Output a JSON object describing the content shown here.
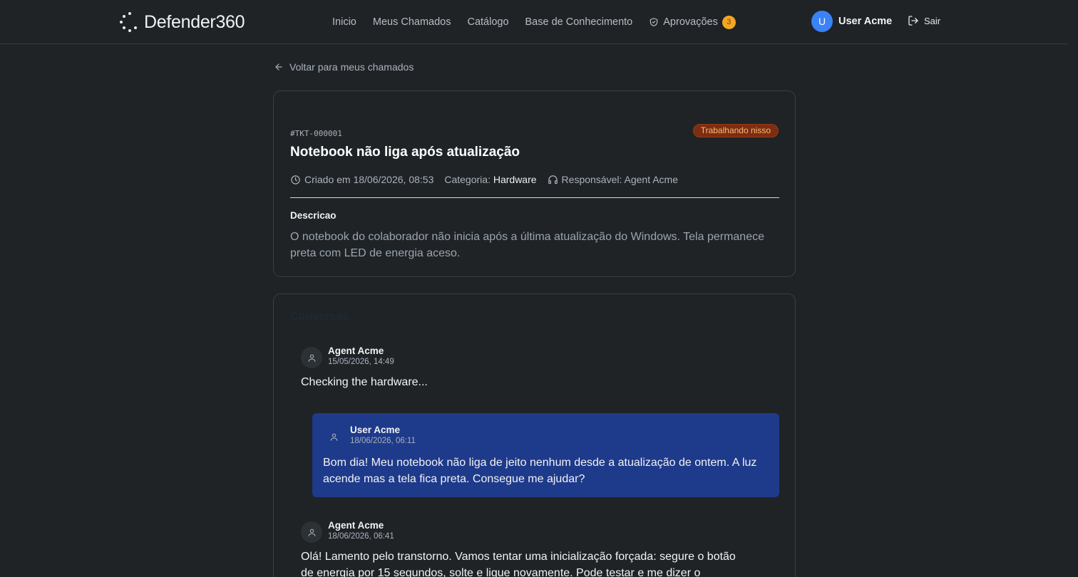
{
  "header": {
    "brand_name": "Defender",
    "brand_number": "360",
    "nav": [
      {
        "label": "Inicio"
      },
      {
        "label": "Meus Chamados"
      },
      {
        "label": "Catálogo"
      },
      {
        "label": "Base de Conhecimento"
      },
      {
        "label": "Aprovações",
        "badge": "3"
      }
    ],
    "user": {
      "initial": "U",
      "name": "User Acme"
    },
    "logout_label": "Sair"
  },
  "back_link": "Voltar para meus chamados",
  "ticket": {
    "id": "#TKT-000001",
    "status": "Trabalhando nisso",
    "title": "Notebook não liga após atualização",
    "created": "Criado em 18/06/2026, 08:53",
    "category_label": "Categoria:",
    "category_value": "Hardware",
    "assignee": "Responsável: Agent Acme",
    "description_label": "Descricao",
    "description": "O notebook do colaborador não inicia após a última atualização do Windows. Tela permanece preta com LED de energia aceso."
  },
  "conversation": {
    "title": "Conversas",
    "messages": [
      {
        "author": "Agent Acme",
        "time": "15/05/2026, 14:49",
        "text": "Checking the hardware..."
      },
      {
        "author": "User Acme",
        "time": "18/06/2026, 06:11",
        "text": "Bom dia! Meu notebook não liga de jeito nenhum desde a atualização de ontem. A luz acende mas a tela fica preta. Consegue me ajudar?"
      },
      {
        "author": "Agent Acme",
        "time": "18/06/2026, 06:41",
        "text": "Olá! Lamento pelo transtorno. Vamos tentar uma inicialização forçada: segure o botão de energia por 15 segundos, solte e ligue novamente. Pode testar e me dizer o"
      }
    ]
  },
  "colors": {
    "background": "#1f2326",
    "status_bg": "#7c2d12",
    "status_text": "#fdba74",
    "user_bubble": "#1e3a8a",
    "badge": "#f5a623",
    "avatar": "#3b82f6"
  }
}
